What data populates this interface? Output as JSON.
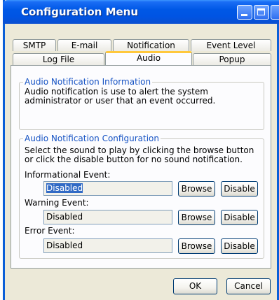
{
  "window": {
    "title": "Configuration Menu"
  },
  "tabs": {
    "row_back": [
      "SMTP",
      "E-mail",
      "Notification",
      "Event Level"
    ],
    "row_front": [
      "Log File",
      "Audio",
      "Popup"
    ],
    "active": "Audio"
  },
  "info_group": {
    "title": "Audio Notification Information",
    "text": "Audio notification is use to alert the system administrator or user that an event occurred."
  },
  "config_group": {
    "title": "Audio Notification Configuration",
    "instructions": "Select the sound to play by clicking the browse button or click the disable button for no sound notification.",
    "events": [
      {
        "label": "Informational Event:",
        "value": "Disabled",
        "browse": "Browse",
        "disable": "Disable"
      },
      {
        "label": "Warning Event:",
        "value": "Disabled",
        "browse": "Browse",
        "disable": "Disable"
      },
      {
        "label": "Error Event:",
        "value": "Disabled",
        "browse": "Browse",
        "disable": "Disable"
      }
    ]
  },
  "footer": {
    "ok": "OK",
    "cancel": "Cancel"
  },
  "colors": {
    "titlebar": "#0054e3",
    "group_title": "#1653c4",
    "tab_highlight": "#ffc83c",
    "selection": "#316ac5"
  }
}
